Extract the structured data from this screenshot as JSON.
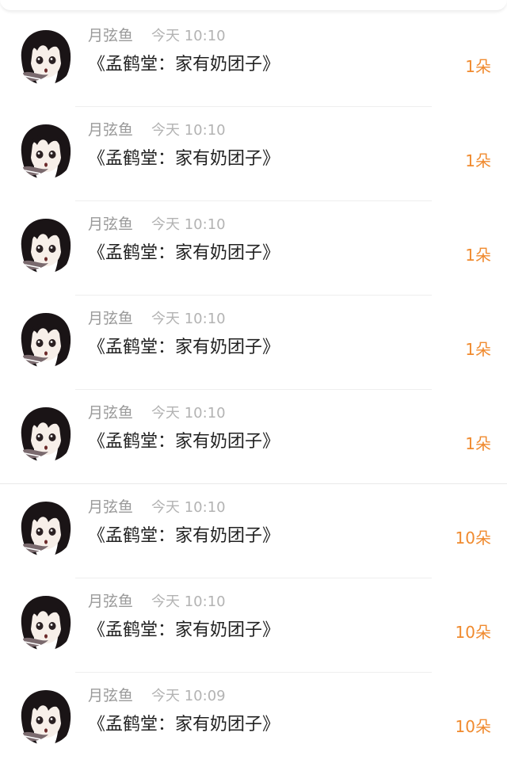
{
  "colors": {
    "amount": "#f08a2e",
    "name": "#9a9a9a",
    "time": "#b3b3b3",
    "message": "#222222",
    "divider": "#eeeeee"
  },
  "avatar_icon": "anime-girl-avatar",
  "items": [
    {
      "name": "月弦鱼",
      "time": "今天 10:10",
      "message": "《孟鹤堂：家有奶团子》",
      "amount": "1朵"
    },
    {
      "name": "月弦鱼",
      "time": "今天 10:10",
      "message": "《孟鹤堂：家有奶团子》",
      "amount": "1朵"
    },
    {
      "name": "月弦鱼",
      "time": "今天 10:10",
      "message": "《孟鹤堂：家有奶团子》",
      "amount": "1朵"
    },
    {
      "name": "月弦鱼",
      "time": "今天 10:10",
      "message": "《孟鹤堂：家有奶团子》",
      "amount": "1朵"
    },
    {
      "name": "月弦鱼",
      "time": "今天 10:10",
      "message": "《孟鹤堂：家有奶团子》",
      "amount": "1朵"
    },
    {
      "name": "月弦鱼",
      "time": "今天 10:10",
      "message": "《孟鹤堂：家有奶团子》",
      "amount": "10朵"
    },
    {
      "name": "月弦鱼",
      "time": "今天 10:10",
      "message": "《孟鹤堂：家有奶团子》",
      "amount": "10朵"
    },
    {
      "name": "月弦鱼",
      "time": "今天 10:09",
      "message": "《孟鹤堂：家有奶团子》",
      "amount": "10朵"
    }
  ]
}
